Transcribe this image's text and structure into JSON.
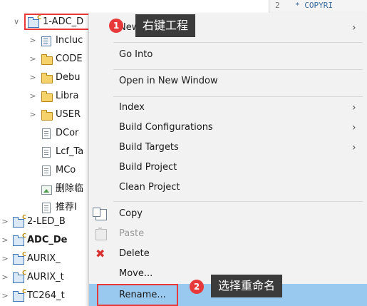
{
  "tree": {
    "items": [
      {
        "twisty": "∨",
        "icon": "project-icon",
        "label": "1-ADC_D",
        "bold": false
      },
      {
        "twisty": ">",
        "icon": "includes-icon",
        "label": "Incluc",
        "bold": false
      },
      {
        "twisty": ">",
        "icon": "folder-icon",
        "label": "CODE",
        "bold": false
      },
      {
        "twisty": ">",
        "icon": "folder-icon",
        "label": "Debu",
        "bold": false
      },
      {
        "twisty": ">",
        "icon": "folder-icon",
        "label": "Libra",
        "bold": false
      },
      {
        "twisty": ">",
        "icon": "folder-icon",
        "label": "USER",
        "bold": false
      },
      {
        "twisty": "",
        "icon": "file-icon",
        "label": "DCor",
        "bold": false
      },
      {
        "twisty": "",
        "icon": "file-icon",
        "label": "Lcf_Ta",
        "bold": false
      },
      {
        "twisty": "",
        "icon": "file-icon",
        "label": "MCo",
        "bold": false
      },
      {
        "twisty": "",
        "icon": "image-file-icon",
        "label": "删除临",
        "bold": false
      },
      {
        "twisty": "",
        "icon": "file-icon",
        "label": "推荐I",
        "bold": false
      },
      {
        "twisty": ">",
        "icon": "project-icon",
        "label": "2-LED_B",
        "bold": false
      },
      {
        "twisty": ">",
        "icon": "project-icon",
        "label": "ADC_De",
        "bold": true
      },
      {
        "twisty": ">",
        "icon": "project-icon",
        "label": "AURIX_",
        "bold": false
      },
      {
        "twisty": ">",
        "icon": "project-icon",
        "label": "AURIX_t",
        "bold": false
      },
      {
        "twisty": ">",
        "icon": "project-icon",
        "label": "TC264_t",
        "bold": false
      }
    ]
  },
  "editor": {
    "line_number": "2",
    "code_text": "* COPYRI"
  },
  "menu": {
    "items": [
      {
        "label": "New",
        "submenu": true,
        "disabled": false
      },
      {
        "label": "Go Into",
        "submenu": false,
        "disabled": false
      },
      {
        "label": "Open in New Window",
        "submenu": false,
        "disabled": false
      },
      {
        "label": "Index",
        "submenu": true,
        "disabled": false
      },
      {
        "label": "Build Configurations",
        "submenu": true,
        "disabled": false
      },
      {
        "label": "Build Targets",
        "submenu": true,
        "disabled": false
      },
      {
        "label": "Build Project",
        "submenu": false,
        "disabled": false
      },
      {
        "label": "Clean Project",
        "submenu": false,
        "disabled": false
      },
      {
        "label": "Copy",
        "submenu": false,
        "disabled": false,
        "icon": "copy-icon"
      },
      {
        "label": "Paste",
        "submenu": false,
        "disabled": true,
        "icon": "paste-icon"
      },
      {
        "label": "Delete",
        "submenu": false,
        "disabled": false,
        "icon": "delete-icon"
      },
      {
        "label": "Move...",
        "submenu": false,
        "disabled": false
      },
      {
        "label": "Rename...",
        "submenu": false,
        "disabled": false,
        "selected": true
      }
    ],
    "submenu_glyph": "›"
  },
  "annotations": {
    "step1": {
      "number": "1",
      "text": "右键工程"
    },
    "step2": {
      "number": "2",
      "text": "选择重命名"
    },
    "color": "#e8393a"
  },
  "colors": {
    "menu_background": "#f2f2f2",
    "selection": "#99c9ef",
    "callout_background": "#3b3b3b"
  }
}
